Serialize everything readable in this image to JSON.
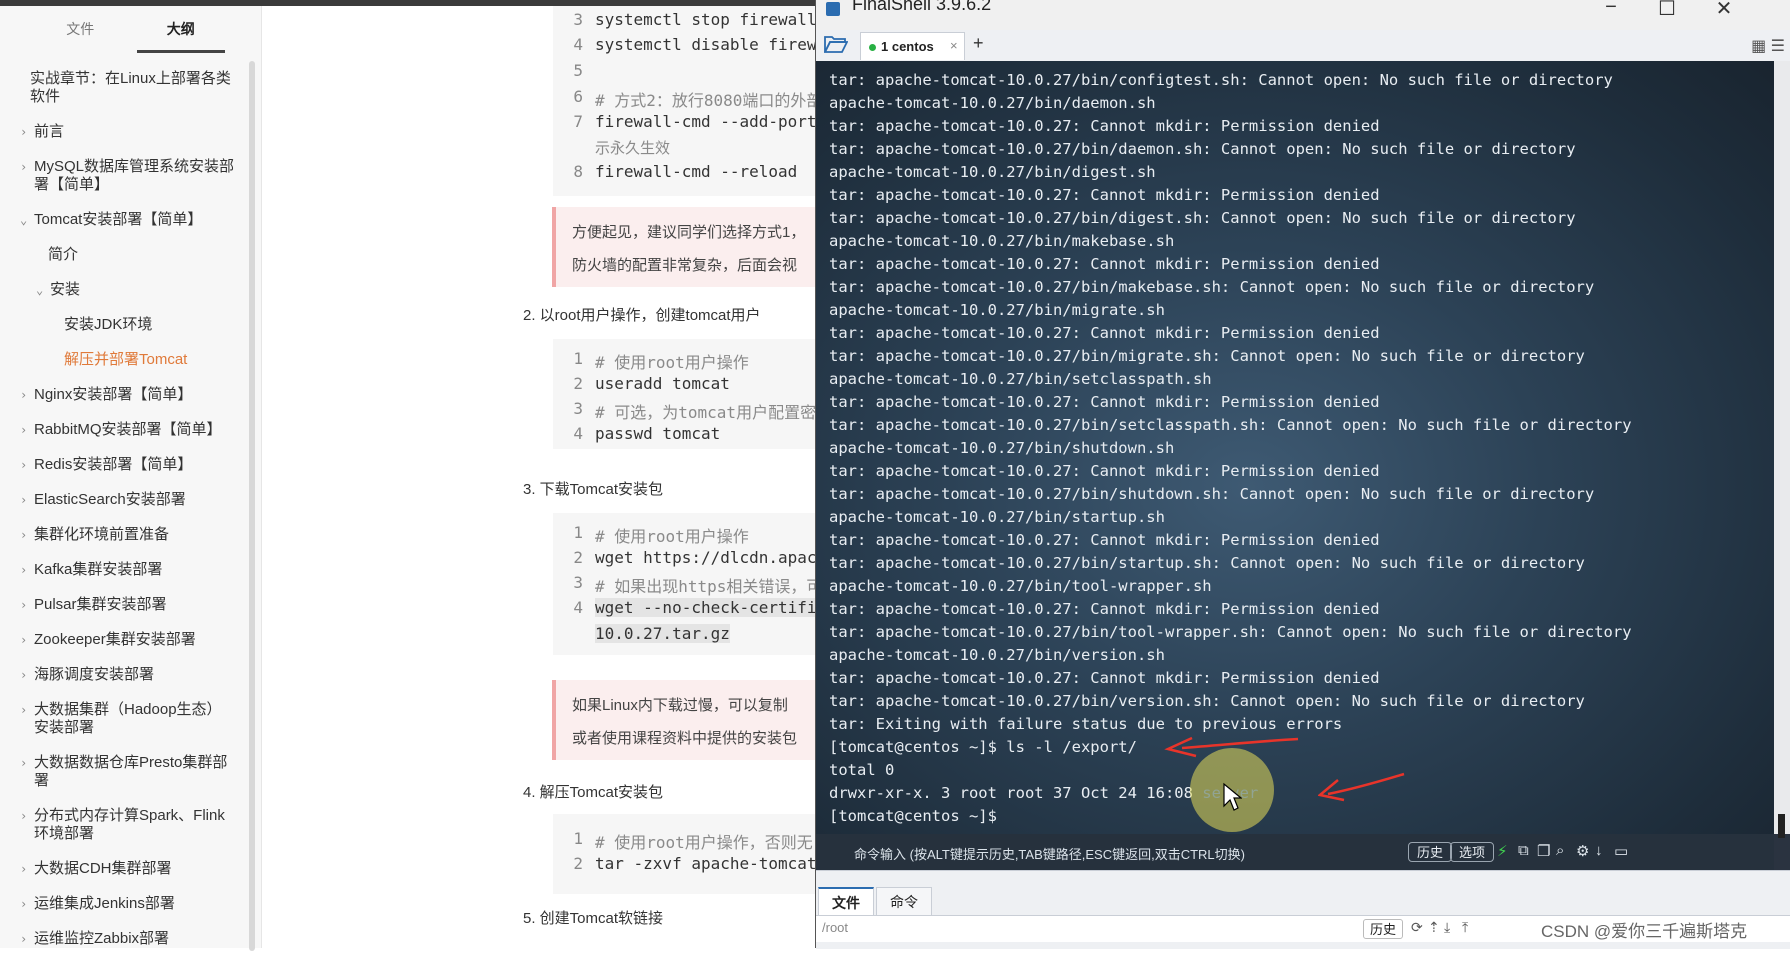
{
  "sidebar": {
    "tabs": [
      {
        "label": "文件"
      },
      {
        "label": "大纲"
      }
    ],
    "items": [
      {
        "label": "实战章节：在Linux上部署各类软件"
      },
      {
        "label": "前言"
      },
      {
        "label": "MySQL数据库管理系统安装部署【简单】"
      },
      {
        "label": "Tomcat安装部署【简单】"
      },
      {
        "label": "简介"
      },
      {
        "label": "安装"
      },
      {
        "label": "安装JDK环境"
      },
      {
        "label": "解压并部署Tomcat"
      },
      {
        "label": "Nginx安装部署【简单】"
      },
      {
        "label": "RabbitMQ安装部署【简单】"
      },
      {
        "label": "Redis安装部署【简单】"
      },
      {
        "label": "ElasticSearch安装部署"
      },
      {
        "label": "集群化环境前置准备"
      },
      {
        "label": "Kafka集群安装部署"
      },
      {
        "label": "Pulsar集群安装部署"
      },
      {
        "label": "Zookeeper集群安装部署"
      },
      {
        "label": "海豚调度安装部署"
      },
      {
        "label": "大数据集群（Hadoop生态）安装部署"
      },
      {
        "label": "大数据数据仓库Presto集群部署"
      },
      {
        "label": "分布式内存计算Spark、Flink环境部署"
      },
      {
        "label": "大数据CDH集群部署"
      },
      {
        "label": "运维集成Jenkins部署"
      },
      {
        "label": "运维监控Zabbix部署"
      }
    ]
  },
  "doc": {
    "code1": {
      "line_numbers": [
        "3",
        "4",
        "5",
        "6",
        "7",
        "8"
      ],
      "lines": [
        "systemctl stop firewall",
        "systemctl disable firew",
        "",
        "# 方式2：放行8080端口的外部",
        "firewall-cmd --add-port",
        "firewall-cmd --reload"
      ],
      "wrap": "示永久生效"
    },
    "callout1": [
      "方便起见，建议同学们选择方式1，",
      "防火墙的配置非常复杂，后面会视"
    ],
    "step2": "2. 以root用户操作，创建tomcat用户",
    "code2": {
      "line_numbers": [
        "1",
        "2",
        "3",
        "4"
      ],
      "lines": [
        "# 使用root用户操作",
        "useradd tomcat",
        "# 可选，为tomcat用户配置密",
        "passwd tomcat"
      ]
    },
    "step3": "3. 下载Tomcat安装包",
    "code3": {
      "line_numbers": [
        "1",
        "2",
        "3",
        "4"
      ],
      "lines": [
        "# 使用root用户操作",
        "wget https://dlcdn.apac",
        "# 如果出现https相关错误，可",
        "wget --no-check-certifi"
      ],
      "wrap": "10.0.27.tar.gz"
    },
    "callout2": [
      "如果Linux内下载过慢，可以复制",
      "或者使用课程资料中提供的安装包"
    ],
    "step4": "4. 解压Tomcat安装包",
    "code4": {
      "line_numbers": [
        "1",
        "2"
      ],
      "lines": [
        "# 使用root用户操作，否则无",
        "tar -zxvf apache-tomcat"
      ]
    },
    "step5": "5. 创建Tomcat软链接"
  },
  "finalshell": {
    "title": "FinalShell 3.9.6.2",
    "tab_label": "1 centos",
    "terminal_lines": [
      "tar: apache-tomcat-10.0.27/bin/configtest.sh: Cannot open: No such file or directory",
      "apache-tomcat-10.0.27/bin/daemon.sh",
      "tar: apache-tomcat-10.0.27: Cannot mkdir: Permission denied",
      "tar: apache-tomcat-10.0.27/bin/daemon.sh: Cannot open: No such file or directory",
      "apache-tomcat-10.0.27/bin/digest.sh",
      "tar: apache-tomcat-10.0.27: Cannot mkdir: Permission denied",
      "tar: apache-tomcat-10.0.27/bin/digest.sh: Cannot open: No such file or directory",
      "apache-tomcat-10.0.27/bin/makebase.sh",
      "tar: apache-tomcat-10.0.27: Cannot mkdir: Permission denied",
      "tar: apache-tomcat-10.0.27/bin/makebase.sh: Cannot open: No such file or directory",
      "apache-tomcat-10.0.27/bin/migrate.sh",
      "tar: apache-tomcat-10.0.27: Cannot mkdir: Permission denied",
      "tar: apache-tomcat-10.0.27/bin/migrate.sh: Cannot open: No such file or directory",
      "apache-tomcat-10.0.27/bin/setclasspath.sh",
      "tar: apache-tomcat-10.0.27: Cannot mkdir: Permission denied",
      "tar: apache-tomcat-10.0.27/bin/setclasspath.sh: Cannot open: No such file or directory",
      "apache-tomcat-10.0.27/bin/shutdown.sh",
      "tar: apache-tomcat-10.0.27: Cannot mkdir: Permission denied",
      "tar: apache-tomcat-10.0.27/bin/shutdown.sh: Cannot open: No such file or directory",
      "apache-tomcat-10.0.27/bin/startup.sh",
      "tar: apache-tomcat-10.0.27: Cannot mkdir: Permission denied",
      "tar: apache-tomcat-10.0.27/bin/startup.sh: Cannot open: No such file or directory",
      "apache-tomcat-10.0.27/bin/tool-wrapper.sh",
      "tar: apache-tomcat-10.0.27: Cannot mkdir: Permission denied",
      "tar: apache-tomcat-10.0.27/bin/tool-wrapper.sh: Cannot open: No such file or directory",
      "apache-tomcat-10.0.27/bin/version.sh",
      "tar: apache-tomcat-10.0.27: Cannot mkdir: Permission denied",
      "tar: apache-tomcat-10.0.27/bin/version.sh: Cannot open: No such file or directory",
      "tar: Exiting with failure status due to previous errors",
      "[tomcat@centos ~]$ ls -l /export/",
      "total 0",
      "drwxr-xr-x. 3 root root 37 Oct 24 16:08 server",
      "[tomcat@centos ~]$"
    ],
    "command_hint": "命令输入 (按ALT键提示历史,TAB键路径,ESC键返回,双击CTRL切换)",
    "history_button": "历史",
    "options_button": "选项",
    "bottom_tabs": [
      {
        "label": "文件"
      },
      {
        "label": "命令"
      }
    ],
    "path": "/root",
    "path_history_button": "历史",
    "colors": {
      "terminal_text": "#e8edf2",
      "highlight_dir": "#2b5fd9",
      "arrow": "#e8342a"
    }
  },
  "watermark": "CSDN @爱你三千遍斯塔克"
}
